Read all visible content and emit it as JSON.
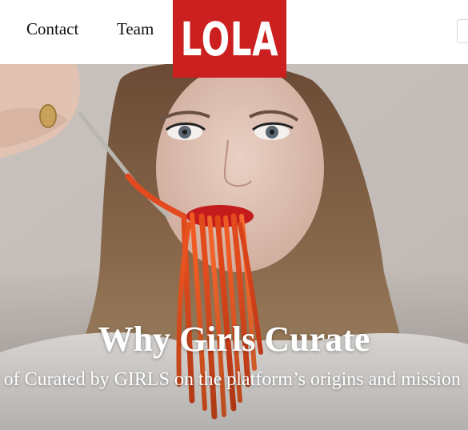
{
  "nav": {
    "contact_label": "Contact",
    "team_label": "Team"
  },
  "logo": {
    "text": "LOLA"
  },
  "hero": {
    "title": "Why Girls Curate",
    "subtitle": "Co-founder of Curated by GIRLS on the platform’s origins and mission"
  },
  "colors": {
    "logo_bg": "#cc1f1f",
    "background": "#ffffff",
    "text": "#111111"
  }
}
